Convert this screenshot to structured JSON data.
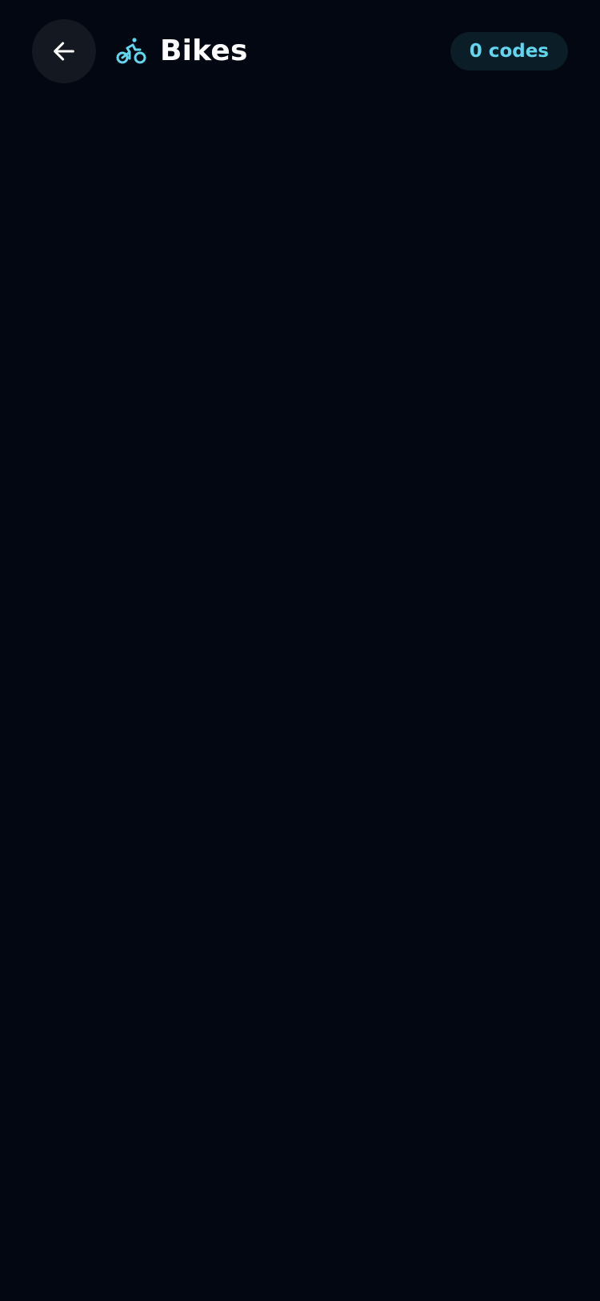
{
  "header": {
    "title": "Bikes",
    "code_count_label": "0 codes"
  },
  "icons": {
    "back": "arrow-left-icon",
    "category": "bike-icon"
  },
  "colors": {
    "background": "#030711",
    "back_button_bg": "#141821",
    "accent": "#62d6ef",
    "badge_bg": "#0b1d27",
    "title_text": "#ffffff"
  }
}
